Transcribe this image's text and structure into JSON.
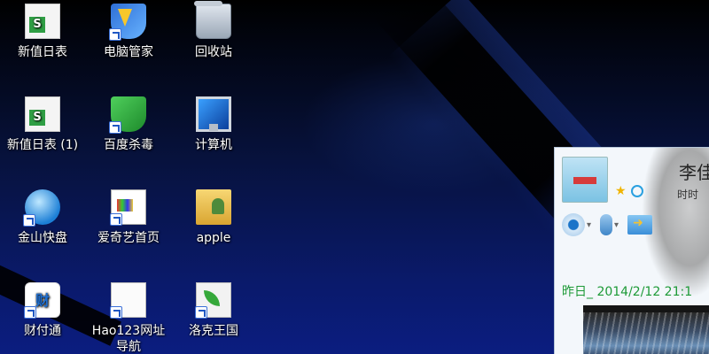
{
  "desktop": {
    "icons": [
      {
        "label": "新值日表",
        "icon": "spreadsheet-icon"
      },
      {
        "label": "电脑管家",
        "icon": "pc-manager-shield-icon"
      },
      {
        "label": "回收站",
        "icon": "recycle-bin-icon"
      },
      {
        "label": "新值日表 (1)",
        "icon": "spreadsheet-icon"
      },
      {
        "label": "百度杀毒",
        "icon": "baidu-antivirus-icon"
      },
      {
        "label": "计算机",
        "icon": "computer-icon"
      },
      {
        "label": "金山快盘",
        "icon": "kuaipan-icon"
      },
      {
        "label": "爱奇艺首页",
        "icon": "iqiyi-page-icon"
      },
      {
        "label": "apple",
        "icon": "user-folder-icon"
      },
      {
        "label": "财付通",
        "icon": "tenpay-icon"
      },
      {
        "label": "Hao123网址导航",
        "icon": "hao123-page-icon"
      },
      {
        "label": "洛克王国",
        "icon": "roco-kingdom-icon"
      }
    ]
  },
  "chat_window": {
    "contact_name": "李佳",
    "status_text": "时时",
    "message_time": "昨日_ 2014/2/12 21:1",
    "colors": {
      "time_text": "#1d9a37",
      "panel_bg": "#f3f7fb"
    }
  }
}
